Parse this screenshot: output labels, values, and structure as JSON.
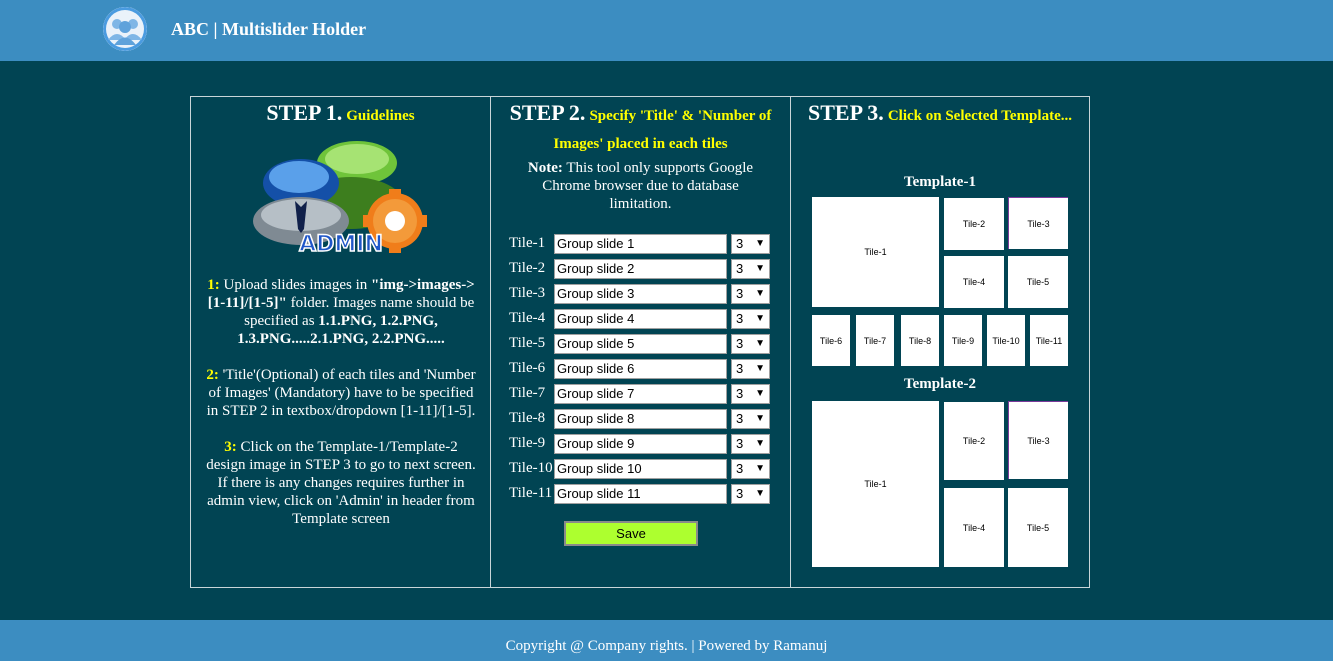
{
  "header": {
    "title": "ABC | Multislider Holder",
    "logo_icon": "users-icon"
  },
  "step1": {
    "heading": "STEP 1.",
    "subheading": "Guidelines",
    "image_text": "ADMIN",
    "g1_num": "1:",
    "g1_a": " Upload slides images in ",
    "g1_b": "\"img->images->[1-11]/[1-5]\"",
    "g1_c": " folder. Images name should be specified as ",
    "g1_d": "1.1.PNG, 1.2.PNG, 1.3.PNG.....2.1.PNG, 2.2.PNG.....",
    "g2_num": "2:",
    "g2_text": " 'Title'(Optional) of each tiles and 'Number of Images' (Mandatory) have to be specified in STEP 2 in textbox/dropdown [1-11]/[1-5].",
    "g3_num": "3:",
    "g3_text": " Click on the Template-1/Template-2 design image in STEP 3 to go to next screen. If there is any changes requires further in admin view, click on 'Admin' in header from Template screen"
  },
  "step2": {
    "heading": "STEP 2.",
    "subheading": "Specify 'Title' & 'Number of Images' placed in each tiles",
    "note_label": "Note:",
    "note_text": " This tool only supports Google Chrome browser due to database limitation.",
    "rows": [
      {
        "label": "Tile-1",
        "value": "Group slide 1",
        "count": "3"
      },
      {
        "label": "Tile-2",
        "value": "Group slide 2",
        "count": "3"
      },
      {
        "label": "Tile-3",
        "value": "Group slide 3",
        "count": "3"
      },
      {
        "label": "Tile-4",
        "value": "Group slide 4",
        "count": "3"
      },
      {
        "label": "Tile-5",
        "value": "Group slide 5",
        "count": "3"
      },
      {
        "label": "Tile-6",
        "value": "Group slide 6",
        "count": "3"
      },
      {
        "label": "Tile-7",
        "value": "Group slide 7",
        "count": "3"
      },
      {
        "label": "Tile-8",
        "value": "Group slide 8",
        "count": "3"
      },
      {
        "label": "Tile-9",
        "value": "Group slide 9",
        "count": "3"
      },
      {
        "label": "Tile-10",
        "value": "Group slide 10",
        "count": "3"
      },
      {
        "label": "Tile-11",
        "value": "Group slide 11",
        "count": "3"
      }
    ],
    "save_label": "Save"
  },
  "step3": {
    "heading": "STEP 3.",
    "subheading": "Click on Selected Template...",
    "template1": {
      "title": "Template-1",
      "tiles": [
        "Tile-1",
        "Tile-2",
        "Tile-3",
        "Tile-4",
        "Tile-5",
        "Tile-6",
        "Tile-7",
        "Tile-8",
        "Tile-9",
        "Tile-10",
        "Tile-11"
      ]
    },
    "template2": {
      "title": "Template-2",
      "tiles": [
        "Tile-1",
        "Tile-2",
        "Tile-3",
        "Tile-4",
        "Tile-5"
      ]
    }
  },
  "footer": {
    "text": "Copyright @ Company rights. | Powered by Ramanuj"
  },
  "colors": {
    "header": "#3c8dc1",
    "background": "#014453",
    "accent": "#ffff00",
    "save": "#adff2f"
  }
}
